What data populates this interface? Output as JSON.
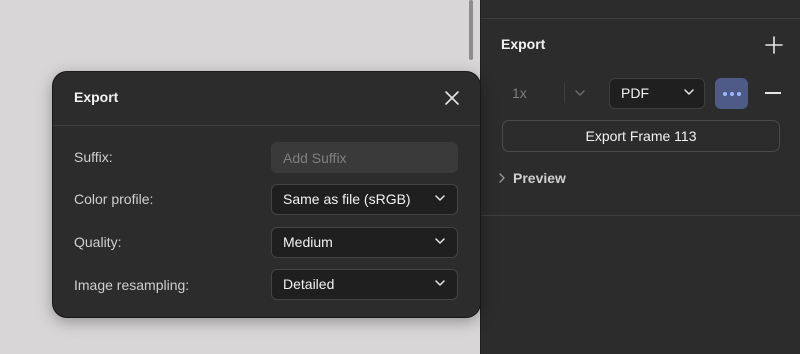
{
  "panel": {
    "title": "Export",
    "scale_value": "1x",
    "format_value": "PDF",
    "export_button_label": "Export Frame 113",
    "preview_label": "Preview"
  },
  "dialog": {
    "title": "Export",
    "fields": {
      "suffix": {
        "label": "Suffix:",
        "placeholder": "Add Suffix",
        "value": ""
      },
      "color_profile": {
        "label": "Color profile:",
        "value": "Same as file (sRGB)"
      },
      "quality": {
        "label": "Quality:",
        "value": "Medium"
      },
      "resampling": {
        "label": "Image resampling:",
        "value": "Detailed"
      }
    }
  },
  "icons": {
    "add": "plus-icon",
    "remove": "minus-icon",
    "more": "more-dots-icon",
    "close": "close-icon",
    "dropdown": "chevron-down-icon",
    "expand": "chevron-right-icon"
  },
  "colors": {
    "panel_bg": "#2c2c2c",
    "canvas_bg": "#d8d6d7",
    "accent_active": "#4d5b86",
    "accent_dots": "#9fb8ff"
  }
}
